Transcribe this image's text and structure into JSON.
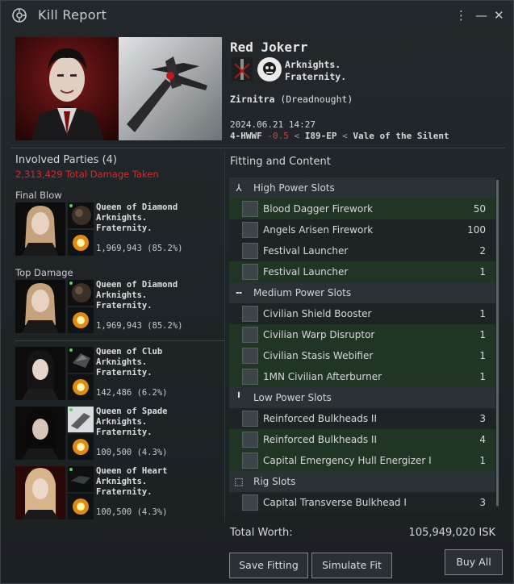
{
  "window": {
    "title": "Kill Report",
    "menu_icon": "kebab-menu-icon",
    "close_icon": "close-icon"
  },
  "victim": {
    "name": "Red Jokerr",
    "corp_line1": "Arknights.",
    "corp_line2": "Fraternity.",
    "ship_name": "Zirnitra",
    "ship_class": "(Dreadnought)",
    "datetime": "2024.06.21 14:27",
    "system": "4-HWWF",
    "security": "-0.5",
    "sep1": "<",
    "region_a": "I89-EP",
    "sep2": "<",
    "region_b": "Vale of the Silent"
  },
  "involved": {
    "title": "Involved Parties (4)",
    "total_damage": "2,313,429 Total Damage Taken",
    "final_blow_label": "Final Blow",
    "top_damage_label": "Top Damage",
    "parties": [
      {
        "name": "Queen of Diamond",
        "corp1": "Arknights.",
        "corp2": "Fraternity.",
        "damage": "1,969,943 (85.2%)"
      },
      {
        "name": "Queen of Diamond",
        "corp1": "Arknights.",
        "corp2": "Fraternity.",
        "damage": "1,969,943 (85.2%)"
      },
      {
        "name": "Queen of Club",
        "corp1": "Arknights.",
        "corp2": "Fraternity.",
        "damage": "142,486 (6.2%)"
      },
      {
        "name": "Queen of Spade",
        "corp1": "Arknights.",
        "corp2": "Fraternity.",
        "damage": "100,500 (4.3%)"
      },
      {
        "name": "Queen of Heart",
        "corp1": "Arknights.",
        "corp2": "Fraternity.",
        "damage": "100,500 (4.3%)"
      }
    ]
  },
  "fitting": {
    "title": "Fitting and Content",
    "rows": [
      {
        "kind": "hdr",
        "label": "High Power Slots",
        "icon": "high-slot-icon"
      },
      {
        "kind": "item",
        "hl": true,
        "label": "Blood Dagger Firework",
        "qty": "50"
      },
      {
        "kind": "item",
        "hl": false,
        "label": "Angels Arisen Firework",
        "qty": "100"
      },
      {
        "kind": "item",
        "hl": false,
        "label": "Festival Launcher",
        "qty": "2"
      },
      {
        "kind": "item",
        "hl": true,
        "label": "Festival Launcher",
        "qty": "1"
      },
      {
        "kind": "hdr",
        "label": "Medium Power Slots",
        "icon": "medium-slot-icon"
      },
      {
        "kind": "item",
        "hl": false,
        "label": "Civilian Shield Booster",
        "qty": "1"
      },
      {
        "kind": "item",
        "hl": true,
        "label": "Civilian Warp Disruptor",
        "qty": "1"
      },
      {
        "kind": "item",
        "hl": true,
        "label": "Civilian Stasis Webifier",
        "qty": "1"
      },
      {
        "kind": "item",
        "hl": true,
        "label": "1MN Civilian Afterburner",
        "qty": "1"
      },
      {
        "kind": "hdr",
        "label": "Low Power Slots",
        "icon": "low-slot-icon"
      },
      {
        "kind": "item",
        "hl": false,
        "label": "Reinforced Bulkheads II",
        "qty": "3"
      },
      {
        "kind": "item",
        "hl": true,
        "label": "Reinforced Bulkheads II",
        "qty": "4"
      },
      {
        "kind": "item",
        "hl": true,
        "label": "Capital Emergency Hull Energizer I",
        "qty": "1"
      },
      {
        "kind": "hdr",
        "label": "Rig Slots",
        "icon": "rig-slot-icon"
      },
      {
        "kind": "item",
        "hl": false,
        "label": "Capital Transverse Bulkhead I",
        "qty": "3"
      }
    ],
    "total_worth_label": "Total Worth:",
    "total_worth_value": "105,949,020 ISK"
  },
  "buttons": {
    "save_fitting": "Save Fitting",
    "simulate_fit": "Simulate Fit",
    "buy_all": "Buy All"
  },
  "colors": {
    "damage_red": "#e02828",
    "security_red": "#d64040",
    "highlight_green": "#213524"
  }
}
